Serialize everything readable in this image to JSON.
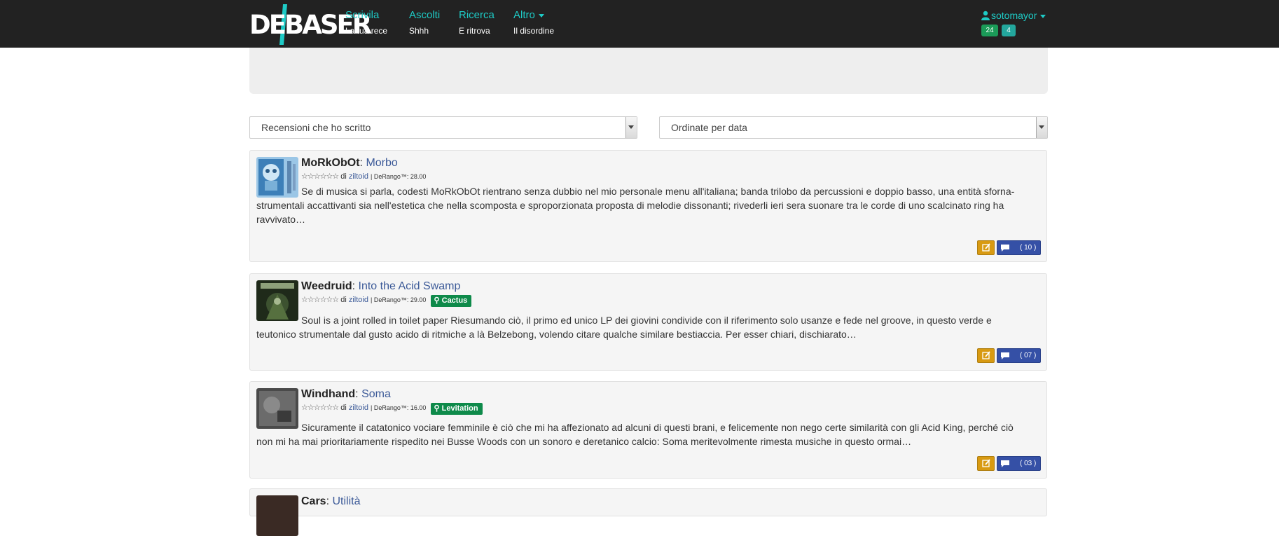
{
  "logo": {
    "text": "DEBASER"
  },
  "nav": [
    {
      "title": "Scrivila",
      "sub": "La tua rece"
    },
    {
      "title": "Ascolti",
      "sub": "Shhh"
    },
    {
      "title": "Ricerca",
      "sub": "E ritrova"
    },
    {
      "title": "Altro",
      "sub": "Il disordine"
    }
  ],
  "user": {
    "name": "sotomayor",
    "count1": "24",
    "count2": "4"
  },
  "filters": {
    "reviews": "Recensioni che ho scritto",
    "order": "Ordinate per data"
  },
  "reviews": [
    {
      "artist": "MoRkObOt",
      "sep": ":",
      "album": "Morbo",
      "by": "di",
      "author": "ziltoid",
      "derango": "| DeRango™: 28.00",
      "award": "",
      "text": "Se di musica si parla, codesti MoRkObOt rientrano senza dubbio nel mio personale menu all'italiana; banda trilobo da percussioni e doppio basso, una entità sforna-strumentali accattivanti sia nell'estetica che nella scomposta e sproporzionata proposta di melodie dissonanti; rivederli ieri sera suonare tra le corde di uno scalcinato ring ha ravvivato…",
      "comments": "( 10 )"
    },
    {
      "artist": "Weedruid",
      "sep": ":",
      "album": "Into the Acid Swamp",
      "by": "di",
      "author": "ziltoid",
      "derango": "| DeRango™: 29.00",
      "award": "Cactus",
      "text": "Soul is a joint rolled in toilet paper Riesumando ciò, il primo ed unico LP dei giovini condivide con il riferimento solo usanze e fede nel groove, in questo verde e teutonico strumentale dal gusto acido di ritmiche a là Belzebong, volendo citare qualche similare bestiaccia. Per esser chiari, dischiarato…",
      "comments": "( 07 )"
    },
    {
      "artist": "Windhand",
      "sep": ":",
      "album": "Soma",
      "by": "di",
      "author": "ziltoid",
      "derango": "| DeRango™: 16.00",
      "award": "Levitation",
      "text": "Sicuramente il catatonico vociare femminile è ciò che mi ha affezionato ad alcuni di questi brani, e felicemente non nego certe similarità con gli Acid King, perché ciò non mi ha mai prioritariamente rispedito nei Busse Woods con un sonoro e deretanico calcio: Soma meritevolmente rimesta musiche in questo ormai…",
      "comments": "( 03 )"
    },
    {
      "artist": "Cars",
      "sep": ":",
      "album": "Utilità",
      "by": "",
      "author": "",
      "derango": "",
      "award": "",
      "text": "",
      "comments": ""
    }
  ],
  "stars": "☆☆☆☆☆☆"
}
